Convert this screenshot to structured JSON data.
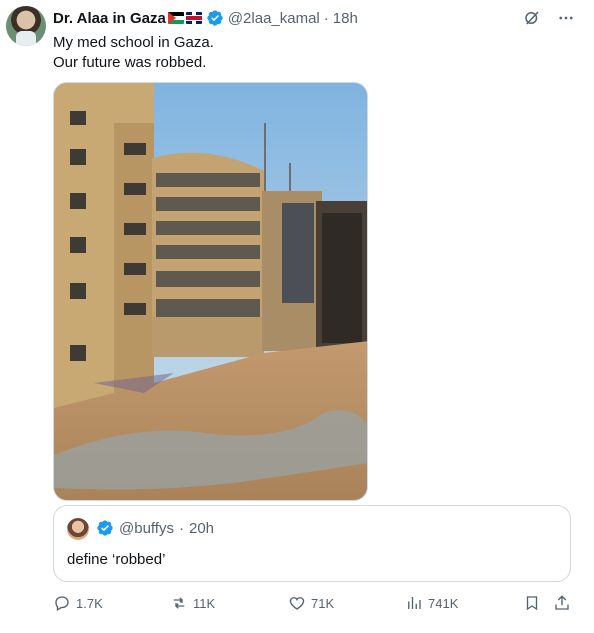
{
  "tweet": {
    "author_name": "Dr. Alaa in Gaza",
    "author_flags": [
      "flag-palestine",
      "flag-uk"
    ],
    "handle": "@2laa_kamal",
    "separator": "·",
    "time": "18h",
    "text_line1": "My med school in Gaza.",
    "text_line2": "Our future was robbed.",
    "image_alt": "Damaged buildings of a medical school"
  },
  "quote": {
    "handle": "@buffys",
    "separator": "·",
    "time": "20h",
    "text": "define ‘robbed’"
  },
  "actions": {
    "replies": "1.7K",
    "reposts": "11K",
    "likes": "71K",
    "views": "741K"
  },
  "icons": {
    "verified": "verified-badge-icon",
    "grok": "grok-icon",
    "more": "more-icon",
    "reply": "reply-icon",
    "repost": "repost-icon",
    "like": "heart-icon",
    "views": "views-icon",
    "bookmark": "bookmark-icon",
    "share": "share-icon"
  },
  "colors": {
    "verified_blue": "#1d9bf0",
    "text_primary": "#0f1419",
    "text_secondary": "#536471",
    "border": "#cfd9de"
  }
}
